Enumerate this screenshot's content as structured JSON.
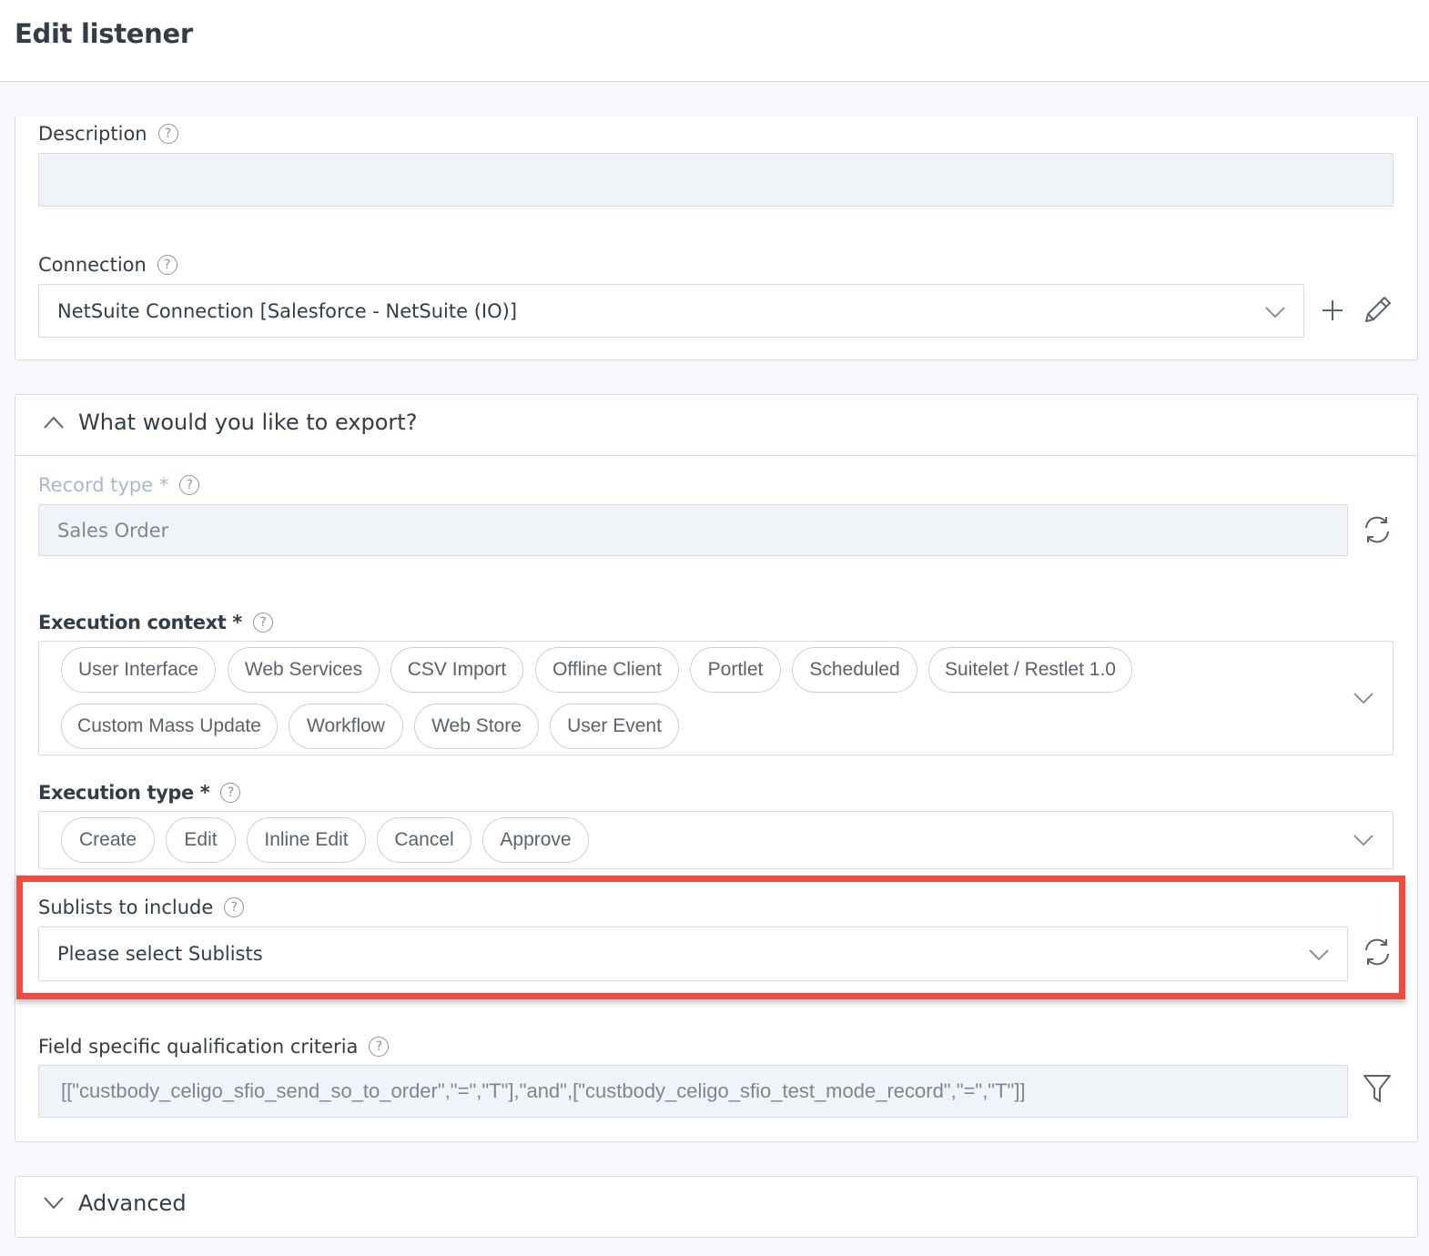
{
  "header": {
    "title": "Edit listener"
  },
  "description": {
    "label": "Description",
    "value": ""
  },
  "connection": {
    "label": "Connection",
    "value": "NetSuite Connection [Salesforce - NetSuite (IO)]"
  },
  "export_section": {
    "title": "What would you like to export?",
    "record_type": {
      "label": "Record type",
      "required_mark": "*",
      "value": "Sales Order"
    },
    "execution_context": {
      "label": "Execution context",
      "required_mark": "*",
      "chips": [
        "User Interface",
        "Web Services",
        "CSV Import",
        "Offline Client",
        "Portlet",
        "Scheduled",
        "Suitelet / Restlet 1.0",
        "Custom Mass Update",
        "Workflow",
        "Web Store",
        "User Event"
      ]
    },
    "execution_type": {
      "label": "Execution type",
      "required_mark": "*",
      "chips": [
        "Create",
        "Edit",
        "Inline Edit",
        "Cancel",
        "Approve"
      ]
    },
    "sublists": {
      "label": "Sublists to include",
      "placeholder": "Please select Sublists"
    },
    "criteria": {
      "label": "Field specific qualification criteria",
      "value": "[[\"custbody_celigo_sfio_send_so_to_order\",\"=\",\"T\"],\"and\",[\"custbody_celigo_sfio_test_mode_record\",\"=\",\"T\"]]"
    }
  },
  "advanced_section": {
    "title": "Advanced"
  },
  "help_symbol": "?",
  "colors": {
    "highlight": "#ee4b42",
    "border": "#d6dce3",
    "text": "#333d47",
    "disabled_label": "#a9b9c9"
  }
}
